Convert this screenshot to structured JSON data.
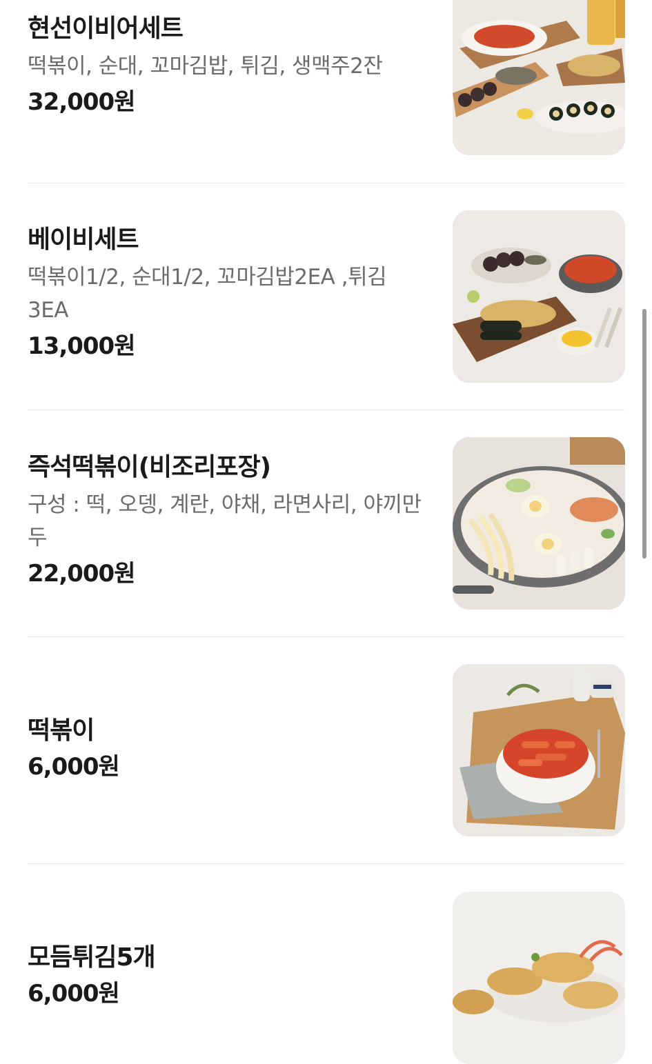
{
  "menu": {
    "items": [
      {
        "name": "현선이비어세트",
        "description": "떡볶이, 순대, 꼬마김밥, 튀김, 생맥주2잔",
        "price": "32,000원",
        "image_icon": "beer-set-food-photo"
      },
      {
        "name": "베이비세트",
        "description": "떡볶이1/2, 순대1/2, 꼬마김밥2EA ,튀김 3EA",
        "price": "13,000원",
        "image_icon": "baby-set-food-photo"
      },
      {
        "name": "즉석떡볶이(비조리포장)",
        "description": "구성 : 떡, 오뎅, 계란, 야채, 라면사리, 야끼만두",
        "price": "22,000원",
        "image_icon": "instant-tteokbokki-food-photo"
      },
      {
        "name": "떡볶이",
        "description": "",
        "price": "6,000원",
        "image_icon": "tteokbokki-food-photo"
      },
      {
        "name": "모듬튀김5개",
        "description": "",
        "price": "6,000원",
        "image_icon": "assorted-fritters-food-photo"
      }
    ]
  },
  "colors": {
    "text_primary": "#1a1a1a",
    "text_secondary": "#6b6b6b",
    "divider": "#ededed",
    "scrollbar": "#9a9a9a"
  }
}
